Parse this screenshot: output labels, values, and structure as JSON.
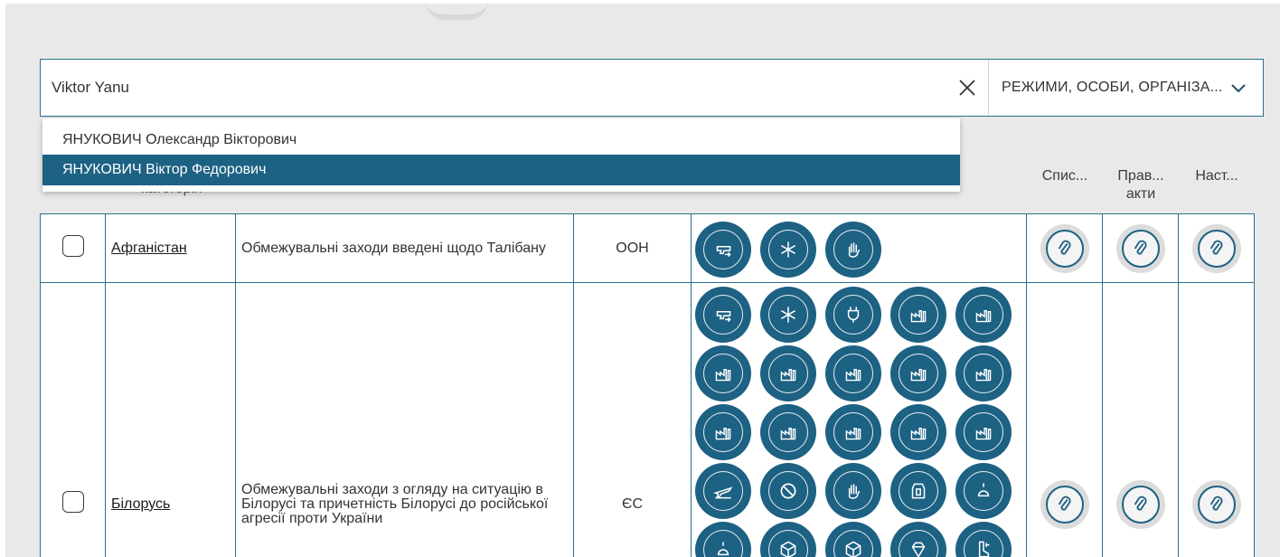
{
  "search": {
    "value": "Viktor Yanu",
    "placeholder": ""
  },
  "scope_select": {
    "selected": "РЕЖИМИ, ОСОБИ, ОРГАНІЗА..."
  },
  "suggestions": [
    {
      "label": "ЯНУКОВИЧ Олександр Вікторович",
      "highlighted": false
    },
    {
      "label": "ЯНУКОВИЧ Віктор Федорович",
      "highlighted": true
    }
  ],
  "table_headers": {
    "category": "категорія",
    "lists": "Спис...",
    "legal_acts_1": "Прав...",
    "legal_acts_2": "акти",
    "settings": "Наст..."
  },
  "rows": [
    {
      "country": "Афганістан",
      "description": "Обмежувальні заходи введені щодо Талібану",
      "source": "ООН",
      "icons": [
        "gun-export-icon",
        "snowflake-freeze-icon",
        "hand-stop-icon"
      ]
    },
    {
      "country": "Білорусь",
      "description": "Обмежувальні заходи з огляду на ситуацію в Білорусі та причетність Білорусі до російської агресії проти України",
      "source": "ЄС",
      "icons": [
        "gun-export-icon",
        "snowflake-freeze-icon",
        "plug-energy-icon",
        "factory-icon",
        "factory-icon",
        "factory-icon",
        "factory-icon",
        "factory-icon",
        "factory-icon",
        "factory-icon",
        "factory-icon",
        "factory-icon",
        "factory-icon",
        "factory-icon",
        "factory-icon",
        "plane-icon",
        "prohibited-icon",
        "hand-stop-icon",
        "vest-icon",
        "crane-icon",
        "crane-icon",
        "cube-icon",
        "cube-icon",
        "diamond-icon",
        "boot-icon"
      ]
    }
  ],
  "colors": {
    "accent": "#1d6183",
    "border": "#2a6f8e",
    "panel_bg": "#e9e9e9",
    "clip_bg": "#dcdcdc"
  }
}
